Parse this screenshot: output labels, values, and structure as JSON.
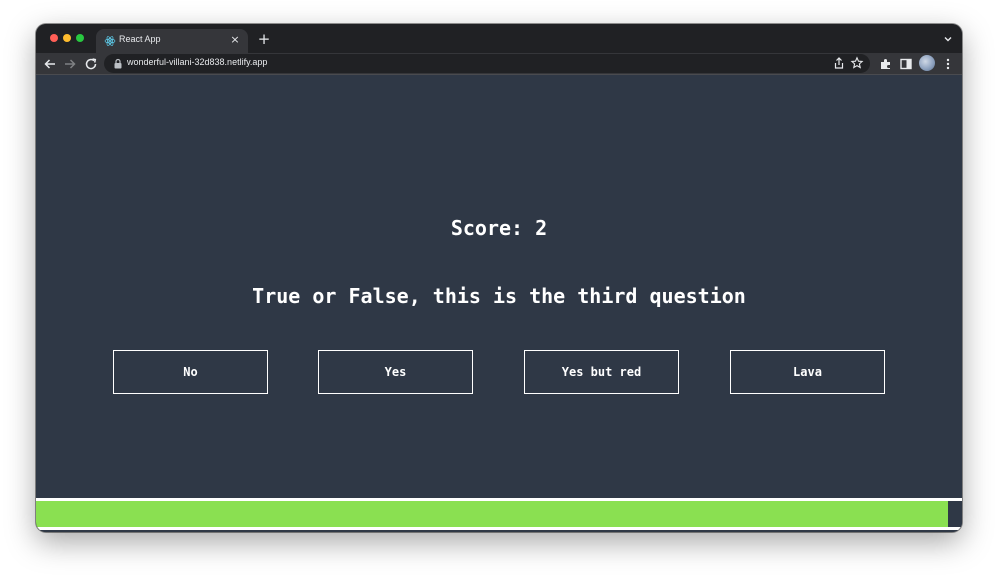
{
  "browser": {
    "tab": {
      "title": "React App",
      "close_glyph": "×",
      "favicon": "react-icon"
    },
    "new_tab_glyph": "+",
    "address_bar": {
      "url": "wonderful-villani-32d838.netlify.app"
    }
  },
  "quiz": {
    "score_label": "Score: 2",
    "question": "True or False, this is the third question",
    "answers": [
      "No",
      "Yes",
      "Yes but red",
      "Lava"
    ],
    "progress_fraction": 0.985,
    "progress_color": "#8ae051"
  },
  "colors": {
    "page_background": "#2f3846",
    "text": "#ffffff",
    "button_border": "#ffffff"
  }
}
